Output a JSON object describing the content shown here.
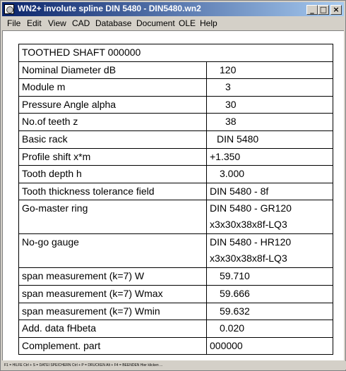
{
  "window": {
    "title": "WN2+  involute spline DIN 5480  -  DIN5480.wn2",
    "minimize": "_",
    "maximize": "□",
    "close": "×"
  },
  "menu": [
    "File",
    "Edit",
    "View",
    "CAD",
    "Database",
    "Document",
    "OLE",
    "Help"
  ],
  "table": {
    "header": "TOOTHED SHAFT 000000",
    "rows": [
      {
        "label": "Nominal Diameter dB",
        "value": "120"
      },
      {
        "label": "Module m",
        "value": "3"
      },
      {
        "label": "Pressure Angle alpha",
        "value": "30"
      },
      {
        "label": "No.of teeth z",
        "value": "38"
      },
      {
        "label": "Basic rack",
        "value": "DIN 5480"
      },
      {
        "label": "Profile shift x*m",
        "value": "+1.350"
      },
      {
        "label": "Tooth depth h",
        "value": "3.000"
      },
      {
        "label": "Tooth thickness tolerance field",
        "value": "DIN 5480 - 8f"
      },
      {
        "label": "Go-master ring",
        "value": "DIN 5480 - GR120",
        "value2": "x3x30x38x8f-LQ3"
      },
      {
        "label": "No-go gauge",
        "value": "DIN 5480 - HR120",
        "value2": "x3x30x38x8f-LQ3"
      },
      {
        "label": "span measurement (k=7) W",
        "value": "59.710"
      },
      {
        "label": "span measurement (k=7) Wmax",
        "value": "59.666"
      },
      {
        "label": "span measurement (k=7) Wmin",
        "value": "59.632"
      },
      {
        "label": "Add. data fHbeta",
        "value": "0.020"
      },
      {
        "label": "Complement. part",
        "value": "000000"
      }
    ]
  },
  "status": "F1 = HILFE  Ctrl + S = DATEI SPEICHERN  Ctrl + P = DRUCKEN  Alt + F4 = BEENDEN  Hier klicken ..."
}
